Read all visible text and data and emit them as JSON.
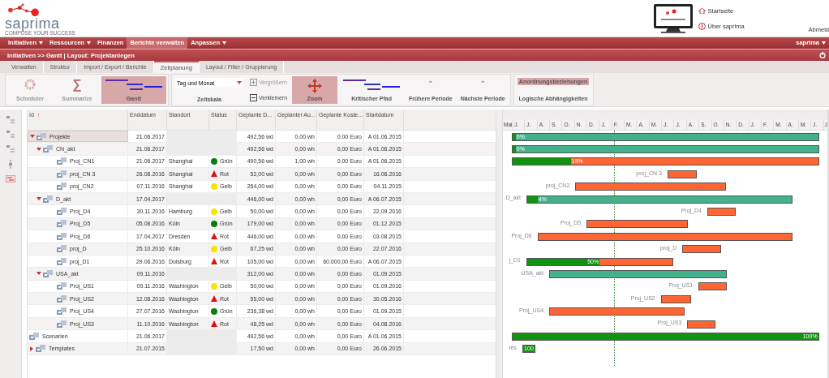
{
  "header": {
    "brand": "saprima",
    "tagline": "COMPOSE YOUR SUCCESS",
    "links": [
      {
        "label": "Startseite",
        "kind": "home"
      },
      {
        "label": "Über saprima",
        "kind": "info"
      }
    ],
    "logout": "Abmeld"
  },
  "menu": [
    {
      "label": "Initiativen",
      "dropdown": true,
      "selected": false
    },
    {
      "label": "Ressourcen",
      "dropdown": true,
      "selected": false
    },
    {
      "label": "Finanzen",
      "dropdown": false,
      "selected": false
    },
    {
      "label": "Berichte verwalten",
      "dropdown": false,
      "selected": true
    },
    {
      "label": "Anpassen",
      "dropdown": true,
      "selected": false
    }
  ],
  "user_menu": {
    "label": "saprima",
    "dropdown": true
  },
  "breadcrumb": "Initiativen >> Gantt | Layout: Projektanlegen",
  "tabs": [
    {
      "label": "Verwalten",
      "selected": false
    },
    {
      "label": "Struktur",
      "selected": false
    },
    {
      "label": "Import / Export / Berichte",
      "selected": false
    },
    {
      "label": "Zeitplanung",
      "selected": true
    },
    {
      "label": "Layout / Filter / Gruppierung",
      "selected": false
    }
  ],
  "ribbon": {
    "scheduler": {
      "label": "Scheduler",
      "disabled": true
    },
    "summarize": {
      "label": "Summarize",
      "icon": "∑",
      "disabled": true
    },
    "gantt": {
      "label": "Gantt",
      "selected": true
    },
    "timescale": {
      "value": "Tag und Monat",
      "label": "Zeitskala"
    },
    "zoom_in": {
      "label": "Vergrößern",
      "disabled": true
    },
    "zoom_out": {
      "label": "Verkleinern",
      "disabled": false
    },
    "zoom": {
      "label": "Zoom",
      "selected": true
    },
    "critical_path": {
      "label": "Kritischer Pfad",
      "selected": false
    },
    "prev": {
      "icon": "‹‹",
      "label": "Frühere Periode"
    },
    "next": {
      "icon": "››",
      "label": "Nächste Periode"
    },
    "dependencies": {
      "label": "Anordnungsbeziehungen",
      "selected": true
    },
    "logical": {
      "label": "Logische Abhängigkeiten",
      "selected": false
    }
  },
  "table": {
    "columns": [
      "Id",
      "Enddatum",
      "Standort",
      "Status",
      "Geplante D...",
      "Geplanter Au...",
      "Geplante Koste...",
      "Startdatum"
    ],
    "sort_icon": "↑",
    "rows": [
      {
        "id": "Projekte",
        "kind": "group",
        "expanded": true,
        "selected": true,
        "end": "21.06.2017",
        "duration": "492,56 wd",
        "effort": "0,00 wh",
        "cost": "0,00 Euro",
        "start": "A 01.06.2015",
        "children": [
          {
            "id": "CN_akt",
            "kind": "group",
            "expanded": true,
            "selected": false,
            "end": "21.06.2017",
            "duration": "492,56 wd",
            "effort": "0,00 wh",
            "cost": "0,00 Euro",
            "start": "A 01.06.2015",
            "children": [
              {
                "id": "Proj_CN1",
                "kind": "project",
                "selected": false,
                "end": "21.06.2017",
                "location": "Shanghai",
                "status": {
                  "label": "Grün",
                  "kind": "ok"
                },
                "duration": "490,56 wd",
                "effort": "1,00 wh",
                "cost": "0,00 Euro",
                "start": "A 01.06.2015"
              },
              {
                "id": "proj_CN 3",
                "kind": "project",
                "selected": false,
                "end": "26.08.2016",
                "location": "Shanghai",
                "status": {
                  "label": "Rot",
                  "kind": "critical"
                },
                "duration": "52,00 wd",
                "effort": "0,00 wh",
                "cost": "0,00 Euro",
                "start": "16.06.2016"
              },
              {
                "id": "proj_CN2",
                "kind": "project",
                "selected": false,
                "end": "07.11.2016",
                "location": "Shanghai",
                "status": {
                  "label": "Gelb",
                  "kind": "warning"
                },
                "duration": "264,00 wd",
                "effort": "0,00 wh",
                "cost": "0,00 Euro",
                "start": "04.11.2015"
              }
            ]
          },
          {
            "id": "D_akt",
            "kind": "group",
            "expanded": true,
            "selected": false,
            "end": "17.04.2017",
            "duration": "446,00 wd",
            "effort": "0,00 wh",
            "cost": "0,00 Euro",
            "start": "A 06.07.2015",
            "children": [
              {
                "id": "Proj_D4",
                "kind": "project",
                "selected": false,
                "end": "30.11.2016",
                "location": "Hamburg",
                "status": {
                  "label": "Gelb",
                  "kind": "warning"
                },
                "duration": "50,00 wd",
                "effort": "0,00 wh",
                "cost": "0,00 Euro",
                "start": "22.09.2016"
              },
              {
                "id": "Proj_D5",
                "kind": "project",
                "selected": false,
                "end": "05.08.2016",
                "location": "Köln",
                "status": {
                  "label": "Grün",
                  "kind": "ok"
                },
                "duration": "179,00 wd",
                "effort": "0,00 wh",
                "cost": "0,00 Euro",
                "start": "01.12.2015"
              },
              {
                "id": "Proj_D6",
                "kind": "project",
                "selected": false,
                "end": "17.04.2017",
                "location": "Dresden",
                "status": {
                  "label": "Rot",
                  "kind": "critical"
                },
                "duration": "446,00 wd",
                "effort": "0,00 wh",
                "cost": "0,00 Euro",
                "start": "03.08.2015"
              },
              {
                "id": "proj_D",
                "kind": "project",
                "selected": false,
                "end": "25.10.2016",
                "location": "Köln",
                "status": {
                  "label": "Gelb",
                  "kind": "warning"
                },
                "duration": "67,25 wd",
                "effort": "0,00 wh",
                "cost": "0,00 Euro",
                "start": "22.07.2016"
              },
              {
                "id": "proj_D1",
                "kind": "project",
                "selected": false,
                "end": "29.06.2016",
                "location": "Duisburg",
                "status": {
                  "label": "Rot",
                  "kind": "critical"
                },
                "duration": "105,00 wd",
                "effort": "0,00 wh",
                "cost": "60.000,00 Euro",
                "start": "A 06.07.2015"
              }
            ]
          },
          {
            "id": "USA_akt",
            "kind": "group",
            "expanded": true,
            "selected": false,
            "end": "09.11.2016",
            "duration": "312,00 wd",
            "effort": "0,00 wh",
            "cost": "0,00 Euro",
            "start": "01.09.2015",
            "children": [
              {
                "id": "Proj_US1",
                "kind": "project",
                "selected": false,
                "end": "09.11.2016",
                "location": "Washington",
                "status": {
                  "label": "Gelb",
                  "kind": "warning"
                },
                "duration": "50,00 wd",
                "effort": "0,00 wh",
                "cost": "0,00 Euro",
                "start": "01.09.2016"
              },
              {
                "id": "Proj_US2",
                "kind": "project",
                "selected": false,
                "end": "12.08.2016",
                "location": "Washington",
                "status": {
                  "label": "Rot",
                  "kind": "critical"
                },
                "duration": "55,00 wd",
                "effort": "0,00 wh",
                "cost": "0,00 Euro",
                "start": "30.05.2016"
              },
              {
                "id": "Proj_US4",
                "kind": "project",
                "selected": false,
                "end": "27.07.2016",
                "location": "Washington",
                "status": {
                  "label": "Grün",
                  "kind": "ok"
                },
                "duration": "236,38 wd",
                "effort": "0,00 wh",
                "cost": "0,00 Euro",
                "start": "01.09.2015"
              },
              {
                "id": "Proj_US3",
                "kind": "project",
                "selected": false,
                "end": "11.10.2016",
                "location": "Washington",
                "status": {
                  "label": "Rot",
                  "kind": "critical"
                },
                "duration": "48,25 wd",
                "effort": "0,00 wh",
                "cost": "0,00 Euro",
                "start": "04.08.2016"
              }
            ]
          }
        ]
      },
      {
        "id": "Scenarien",
        "kind": "group",
        "selected": false,
        "end": "21.06.2017",
        "duration": "492,56 wd",
        "effort": "0,00 wh",
        "cost": "0,00 Euro",
        "start": "A 01.06.2015"
      },
      {
        "id": "Templates",
        "kind": "group",
        "expanded": false,
        "selected": false,
        "end": "21.07.2015",
        "duration": "17,50 wd",
        "effort": "0,00 wh",
        "cost": "0,00 Euro",
        "start": "26.06.2015"
      }
    ]
  },
  "gantt": {
    "timeline": [
      "Mai",
      "J.",
      "J.",
      "A.",
      "S.",
      "O.",
      "N.",
      "D.",
      "J.",
      "F.",
      "M.",
      "A.",
      "M.",
      "J.",
      "J.",
      "A.",
      "S.",
      "O.",
      "N.",
      "D.",
      "J.",
      "F.",
      "M.",
      "A.",
      "M.",
      "J.",
      "J"
    ],
    "bars": [
      {
        "kind": "summary",
        "level": 0.01,
        "percent": "0%"
      },
      {
        "kind": "summary",
        "level": 0.01,
        "percent": "0%"
      },
      {
        "kind": "task",
        "level": 0.19,
        "percent": "19%"
      },
      {
        "kind": "task",
        "label": "proj_CN 3"
      },
      {
        "kind": "task",
        "label": "proj_CN2"
      },
      {
        "kind": "summary",
        "level": 0.04,
        "percent": "4%",
        "label": "D_akt"
      },
      {
        "kind": "task",
        "label": "Proj_D4"
      },
      {
        "kind": "task",
        "label": "Proj_D5"
      },
      {
        "kind": "task",
        "label": "Proj_D6"
      },
      {
        "kind": "task",
        "label": "proj_D"
      },
      {
        "kind": "task",
        "level": 0.5,
        "percent": "50%",
        "label": "j_D1"
      },
      {
        "kind": "summary",
        "label": "USA_akt"
      },
      {
        "kind": "task",
        "label": "Proj_US1"
      },
      {
        "kind": "task",
        "label": "Proj_US2"
      },
      {
        "kind": "task",
        "label": "Proj_US4"
      },
      {
        "kind": "task",
        "label": "Proj_US3"
      },
      {
        "kind": "task",
        "level": 1,
        "percent": "100%"
      },
      {
        "kind": "task",
        "level": 1,
        "percent": "100",
        "label": "tes"
      }
    ]
  }
}
